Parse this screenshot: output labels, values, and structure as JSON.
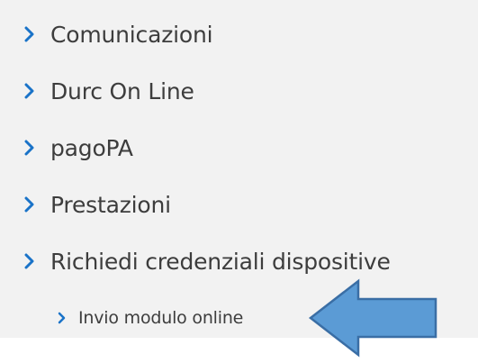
{
  "menu": {
    "items": [
      {
        "label": "Comunicazioni"
      },
      {
        "label": "Durc On Line"
      },
      {
        "label": "pagoPA"
      },
      {
        "label": "Prestazioni"
      },
      {
        "label": "Richiedi credenziali dispositive"
      }
    ],
    "subitems": [
      {
        "label": "Invio modulo online"
      }
    ]
  },
  "colors": {
    "panel_background": "#f2f2f2",
    "chevron": "#1a73c8",
    "text": "#3d3d3d",
    "arrow_fill": "#5b9bd5",
    "arrow_stroke": "#3a6ea5"
  },
  "icons": {
    "chevron": "chevron-right-icon",
    "pointer": "left-arrow-icon"
  }
}
